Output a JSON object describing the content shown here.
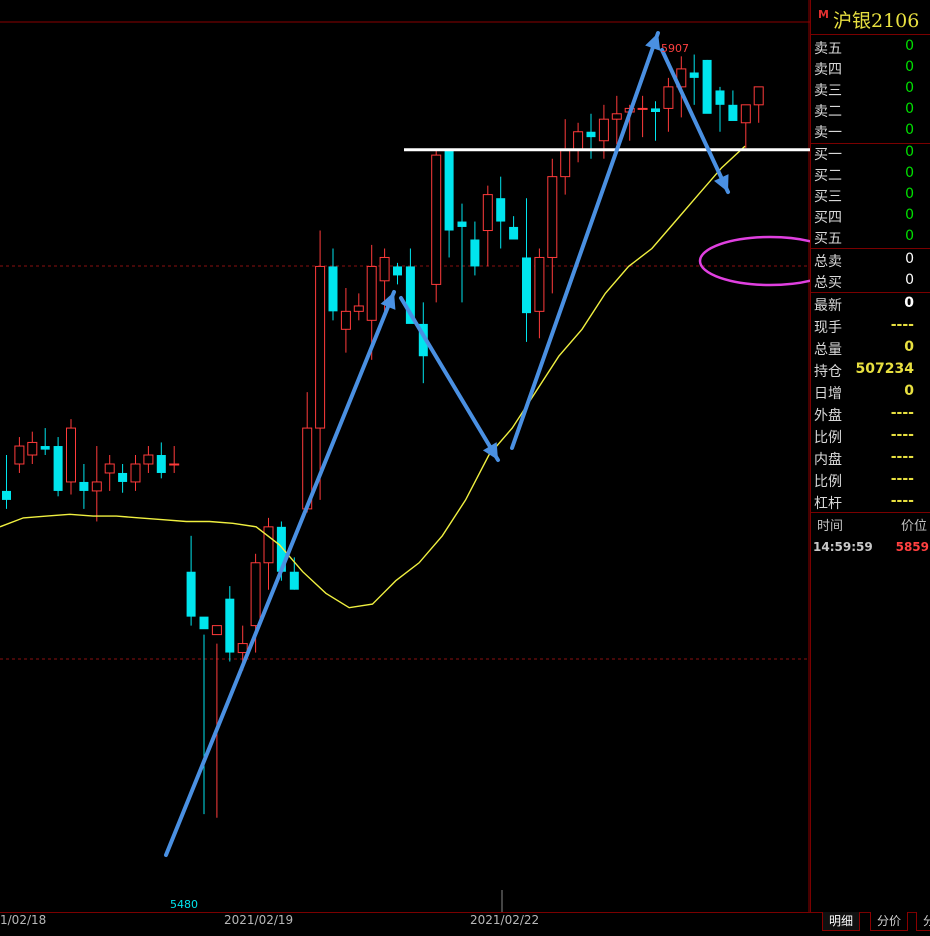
{
  "chart_data": {
    "type": "candlestick",
    "x_dates": [
      "2021/02/18",
      "2021/02/19",
      "2021/02/22"
    ],
    "ylim": [
      5440,
      5925
    ],
    "annotations": {
      "high_label": "5907",
      "low_label": "5480"
    },
    "candles": [
      [
        5665,
        5685,
        5655,
        5660
      ],
      [
        5680,
        5695,
        5675,
        5690
      ],
      [
        5685,
        5698,
        5680,
        5692
      ],
      [
        5690,
        5700,
        5685,
        5688
      ],
      [
        5690,
        5695,
        5662,
        5665
      ],
      [
        5670,
        5705,
        5663,
        5700
      ],
      [
        5670,
        5680,
        5655,
        5665
      ],
      [
        5665,
        5690,
        5648,
        5670
      ],
      [
        5675,
        5685,
        5665,
        5680
      ],
      [
        5675,
        5680,
        5664,
        5670
      ],
      [
        5670,
        5685,
        5665,
        5680
      ],
      [
        5680,
        5690,
        5675,
        5685
      ],
      [
        5685,
        5692,
        5672,
        5675
      ],
      [
        5680,
        5690,
        5675,
        5680
      ],
      [
        5620,
        5640,
        5590,
        5595
      ],
      [
        5595,
        5585,
        5485,
        5588
      ],
      [
        5585,
        5580,
        5483,
        5590
      ],
      [
        5605,
        5612,
        5570,
        5575
      ],
      [
        5575,
        5590,
        5565,
        5580
      ],
      [
        5590,
        5630,
        5575,
        5625
      ],
      [
        5625,
        5650,
        5610,
        5645
      ],
      [
        5645,
        5648,
        5615,
        5620
      ],
      [
        5620,
        5628,
        5610,
        5610
      ],
      [
        5655,
        5720,
        5653,
        5700
      ],
      [
        5700,
        5810,
        5660,
        5790
      ],
      [
        5790,
        5800,
        5760,
        5765
      ],
      [
        5755,
        5778,
        5742,
        5765
      ],
      [
        5765,
        5775,
        5760,
        5768
      ],
      [
        5760,
        5802,
        5738,
        5790
      ],
      [
        5782,
        5800,
        5765,
        5795
      ],
      [
        5790,
        5792,
        5780,
        5785
      ],
      [
        5790,
        5800,
        5760,
        5758
      ],
      [
        5758,
        5770,
        5725,
        5740
      ],
      [
        5780,
        5855,
        5770,
        5852
      ],
      [
        5855,
        5855,
        5795,
        5810
      ],
      [
        5815,
        5825,
        5770,
        5812
      ],
      [
        5805,
        5815,
        5785,
        5790
      ],
      [
        5810,
        5835,
        5790,
        5830
      ],
      [
        5828,
        5840,
        5800,
        5815
      ],
      [
        5812,
        5818,
        5808,
        5805
      ],
      [
        5795,
        5828,
        5748,
        5764
      ],
      [
        5765,
        5800,
        5750,
        5795
      ],
      [
        5795,
        5850,
        5775,
        5840
      ],
      [
        5840,
        5872,
        5830,
        5855
      ],
      [
        5855,
        5870,
        5848,
        5865
      ],
      [
        5865,
        5875,
        5850,
        5862
      ],
      [
        5860,
        5880,
        5850,
        5872
      ],
      [
        5872,
        5885,
        5858,
        5875
      ],
      [
        5876,
        5880,
        5860,
        5878
      ],
      [
        5878,
        5885,
        5862,
        5878
      ],
      [
        5878,
        5882,
        5860,
        5876
      ],
      [
        5878,
        5895,
        5865,
        5890
      ],
      [
        5890,
        5907,
        5873,
        5900
      ],
      [
        5898,
        5908,
        5880,
        5895
      ],
      [
        5905,
        5905,
        5878,
        5875
      ],
      [
        5888,
        5890,
        5865,
        5880
      ],
      [
        5880,
        5888,
        5878,
        5871
      ],
      [
        5870,
        5870,
        5856,
        5880
      ],
      [
        5880,
        5889,
        5870,
        5890
      ]
    ],
    "ma": [
      5645,
      5650,
      5651,
      5652,
      5651,
      5651,
      5650,
      5649,
      5648,
      5648,
      5647,
      5645,
      5635,
      5620,
      5608,
      5600,
      5602,
      5615,
      5625,
      5640,
      5660,
      5685,
      5700,
      5720,
      5740,
      5755,
      5775,
      5790,
      5800,
      5815,
      5830,
      5845,
      5857
    ]
  },
  "panel": {
    "title": "沪银2106",
    "badge": "M",
    "sell": [
      {
        "label": "卖五",
        "value": "0"
      },
      {
        "label": "卖四",
        "value": "0"
      },
      {
        "label": "卖三",
        "value": "0"
      },
      {
        "label": "卖二",
        "value": "0"
      },
      {
        "label": "卖一",
        "value": "0"
      }
    ],
    "buy": [
      {
        "label": "买一",
        "value": "0"
      },
      {
        "label": "买二",
        "value": "0"
      },
      {
        "label": "买三",
        "value": "0"
      },
      {
        "label": "买四",
        "value": "0"
      },
      {
        "label": "买五",
        "value": "0"
      }
    ],
    "totals": [
      {
        "label": "总卖",
        "value": "0"
      },
      {
        "label": "总买",
        "value": "0"
      }
    ],
    "stats": [
      {
        "label": "最新",
        "value": "0",
        "cls": "white qty"
      },
      {
        "label": "现手",
        "value": "----",
        "cls": "yellow dash"
      },
      {
        "label": "总量",
        "value": "0",
        "cls": "yellow qty"
      },
      {
        "label": "持仓",
        "value": "507234",
        "cls": "yellow qty"
      },
      {
        "label": "日增",
        "value": "0",
        "cls": "yellow qty"
      },
      {
        "label": "外盘",
        "value": "----",
        "cls": "yellow dash"
      },
      {
        "label": "比例",
        "value": "----",
        "cls": "yellow dash"
      },
      {
        "label": "内盘",
        "value": "----",
        "cls": "yellow dash"
      },
      {
        "label": "比例",
        "value": "----",
        "cls": "yellow dash"
      },
      {
        "label": "杠杆",
        "value": "----",
        "cls": "yellow dash"
      }
    ],
    "tick_header": {
      "time": "时间",
      "price": "价位"
    },
    "tick": {
      "time": "14:59:59",
      "price": "5859"
    }
  },
  "bottom": {
    "dates": [
      "1/02/18",
      "2021/02/19",
      "2021/02/22"
    ],
    "tabs": [
      "明细",
      "分价",
      "分"
    ]
  },
  "colors": {
    "up": "#ff3b3b",
    "down": "#00e5ee",
    "ma": "#f0f040",
    "arrow": "#4a90e2",
    "circle": "#e040e0",
    "hline": "#ffffff",
    "dashed": "#8a1010"
  }
}
